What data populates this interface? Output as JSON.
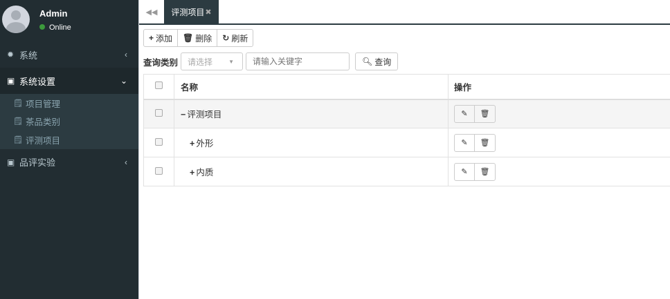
{
  "user": {
    "name": "Admin",
    "status": "Online"
  },
  "sidebar": {
    "menus": [
      {
        "label": "系统",
        "icon": "gear-icon"
      },
      {
        "label": "系统设置",
        "icon": "chart-icon",
        "children": [
          "项目管理",
          "茶品类别",
          "评测项目"
        ]
      },
      {
        "label": "品评实验",
        "icon": "chart-icon"
      }
    ]
  },
  "tabs": [
    {
      "label": "评测项目"
    }
  ],
  "toolbar": {
    "add": "添加",
    "delete": "删除",
    "refresh": "刷新"
  },
  "query": {
    "label": "查询类别",
    "select_placeholder": "请选择",
    "keyword_placeholder": "请输入关键字",
    "button": "查询"
  },
  "table": {
    "headers": [
      "名称",
      "操作"
    ],
    "rows": [
      {
        "toggle": "−",
        "name": "评测项目"
      },
      {
        "toggle": "+",
        "name": "外形"
      },
      {
        "toggle": "+",
        "name": "内质"
      }
    ]
  },
  "colors": {
    "sidebar": "#222d32",
    "active": "#2c3b41"
  }
}
